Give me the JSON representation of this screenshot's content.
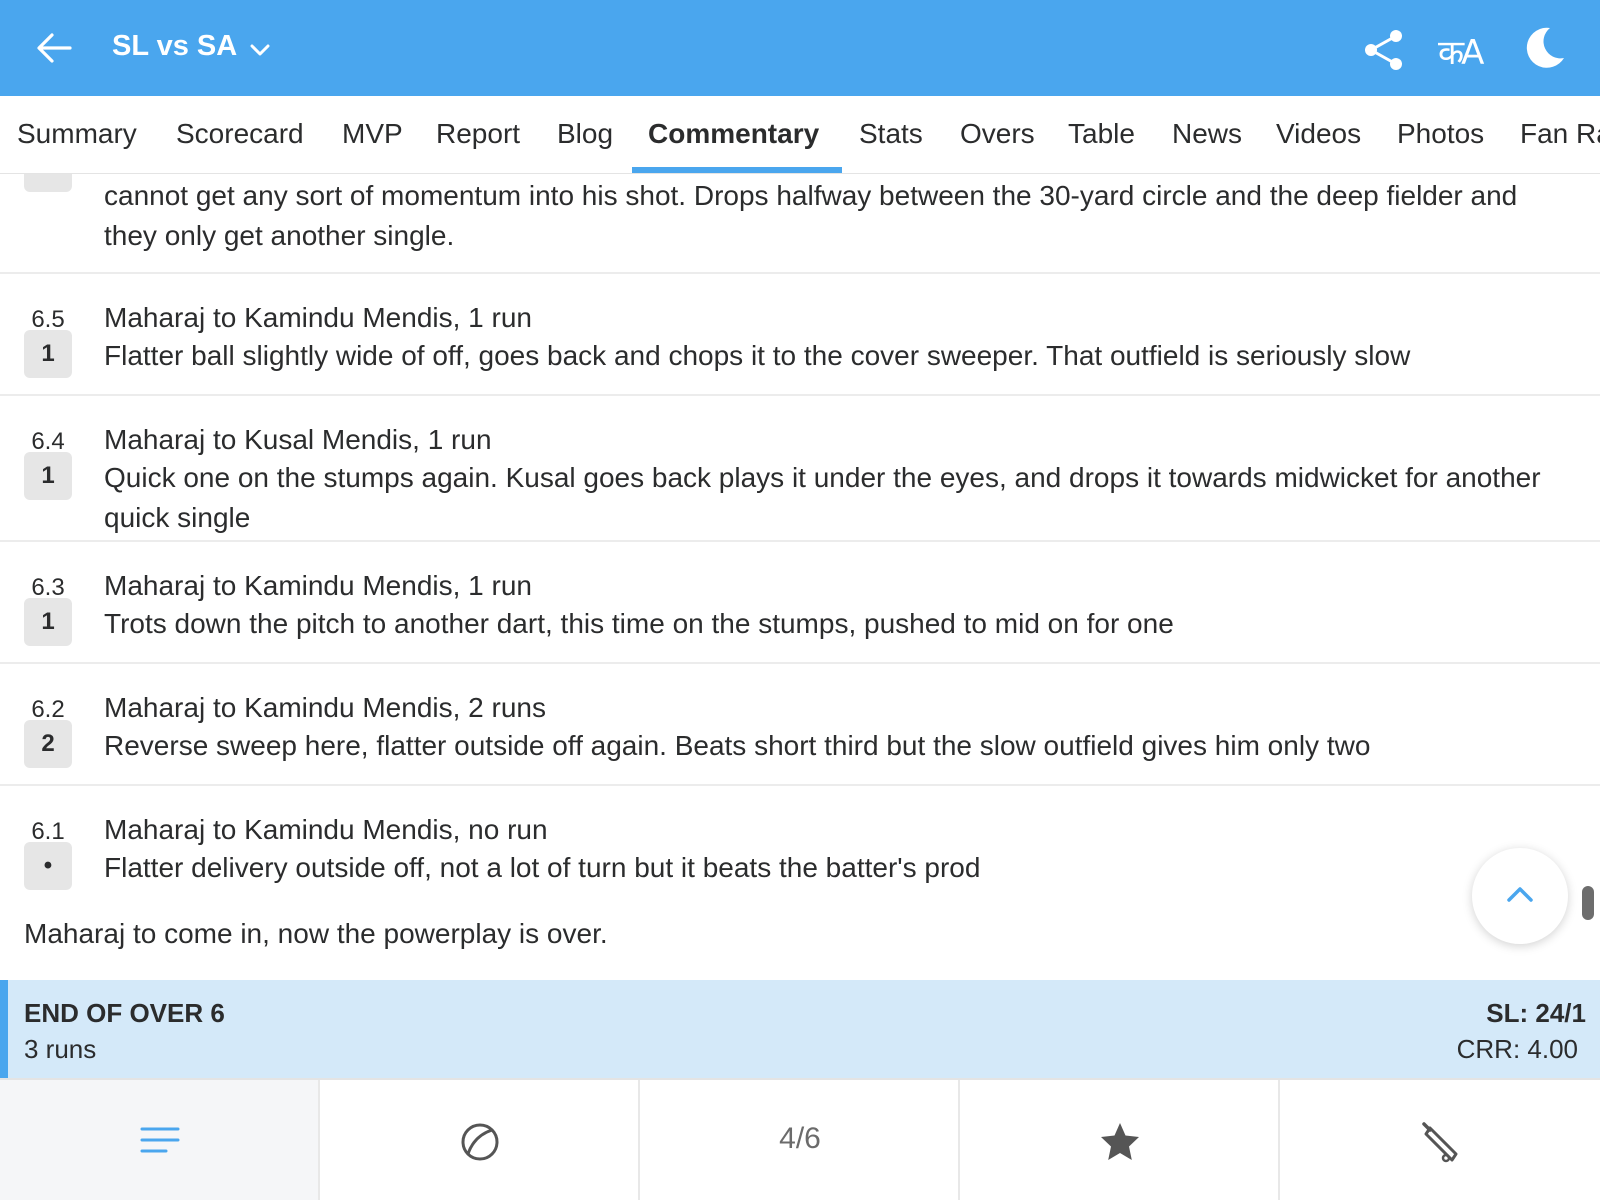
{
  "header": {
    "title": "SL vs SA",
    "lang_label": "कA"
  },
  "tabs": [
    {
      "label": "Summary"
    },
    {
      "label": "Scorecard"
    },
    {
      "label": "MVP"
    },
    {
      "label": "Report"
    },
    {
      "label": "Blog"
    },
    {
      "label": "Commentary",
      "active": true
    },
    {
      "label": "Stats"
    },
    {
      "label": "Overs"
    },
    {
      "label": "Table"
    },
    {
      "label": "News"
    },
    {
      "label": "Videos"
    },
    {
      "label": "Photos"
    },
    {
      "label": "Fan Ra"
    }
  ],
  "commentary": {
    "partial": {
      "text": "cannot get any sort of momentum into his shot. Drops halfway between the 30-yard circle and the deep fielder and they only get another single."
    },
    "balls": [
      {
        "over": "6.5",
        "result": "1",
        "headline": "Maharaj to Kamindu Mendis, 1 run",
        "text": "Flatter ball slightly wide of off, goes back and chops it to the cover sweeper. That outfield is seriously slow"
      },
      {
        "over": "6.4",
        "result": "1",
        "headline": "Maharaj to Kusal Mendis, 1 run",
        "text": "Quick one on the stumps again. Kusal goes back plays it under the eyes, and drops it towards midwicket for another quick single"
      },
      {
        "over": "6.3",
        "result": "1",
        "headline": "Maharaj to Kamindu Mendis, 1 run",
        "text": "Trots down the pitch to another dart, this time on the stumps, pushed to mid on for one"
      },
      {
        "over": "6.2",
        "result": "2",
        "headline": "Maharaj to Kamindu Mendis, 2 runs",
        "text": "Reverse sweep here, flatter outside off again. Beats short third but the slow outfield gives him only two"
      },
      {
        "over": "6.1",
        "result": "•",
        "headline": "Maharaj to Kamindu Mendis, no run",
        "text": "Flatter delivery outside off, not a lot of turn but it beats the batter's prod"
      }
    ],
    "note": "Maharaj to come in, now the powerplay is over."
  },
  "over_end": {
    "title": "END OF OVER 6",
    "runs": "3 runs",
    "score": "SL: 24/1",
    "crr": "CRR: 4.00"
  },
  "bottom_nav": {
    "count": "4/6"
  },
  "colors": {
    "brand": "#4aa6ee",
    "over_end_bg": "#d4e9f9",
    "chip_bg": "#e6e6e6"
  },
  "icons": [
    "back-arrow-icon",
    "chevron-down-icon",
    "share-icon",
    "language-icon",
    "moon-icon",
    "chevron-up-icon",
    "menu-lines-icon",
    "ball-icon",
    "star-icon",
    "bat-icon"
  ]
}
